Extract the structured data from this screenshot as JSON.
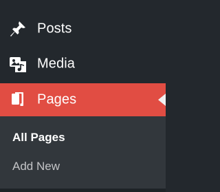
{
  "menu": {
    "items": [
      {
        "label": "Posts",
        "icon": "pushpin-icon"
      },
      {
        "label": "Media",
        "icon": "media-icon"
      },
      {
        "label": "Pages",
        "icon": "pages-icon",
        "active": true
      }
    ],
    "submenu": {
      "items": [
        {
          "label": "All Pages",
          "current": true
        },
        {
          "label": "Add New"
        }
      ]
    }
  },
  "colors": {
    "sidebar_bg": "#23282d",
    "submenu_bg": "#32373c",
    "active_bg": "#e14d43",
    "text": "#ffffff",
    "muted_text": "#c3c4c7",
    "pointer": "#f1f1f1"
  }
}
